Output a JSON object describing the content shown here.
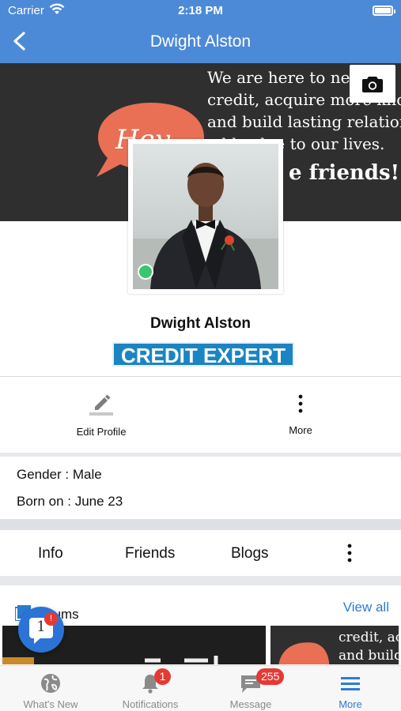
{
  "status_bar": {
    "carrier": "Carrier",
    "time": "2:18 PM"
  },
  "header": {
    "title": "Dwight Alston"
  },
  "cover": {
    "text_lines": [
      "We are here to net",
      "credit, acquire more kno",
      "and build lasting relation",
      "add value to our lives."
    ],
    "friends_text": "e friends!",
    "hey_text": "Hey"
  },
  "profile": {
    "name": "Dwight Alston",
    "title_badge": "CREDIT EXPERT",
    "online": true
  },
  "actions": {
    "edit_profile": "Edit Profile",
    "more": "More"
  },
  "info": {
    "gender": "Gender : Male",
    "born": "Born on : June 23"
  },
  "tabs": [
    "Info",
    "Friends",
    "Blogs"
  ],
  "albums": {
    "title": "Albums",
    "view_all": "View all",
    "thumb2_lines": [
      "credit, ac",
      "and build"
    ]
  },
  "chat_fab": {
    "count": "1",
    "badge": "!"
  },
  "bottom_nav": {
    "items": [
      {
        "label": "What's New",
        "icon": "globe-icon"
      },
      {
        "label": "Notifications",
        "icon": "bell-icon",
        "badge": "1"
      },
      {
        "label": "Message",
        "icon": "chat-icon",
        "badge": "255"
      },
      {
        "label": "More",
        "icon": "menu-icon",
        "active": true
      }
    ]
  },
  "colors": {
    "primary": "#4c8ad8",
    "badge": "#e53935",
    "online": "#3cc46f",
    "title_badge": "#1b85c3",
    "hey_bubble": "#e96f55"
  }
}
